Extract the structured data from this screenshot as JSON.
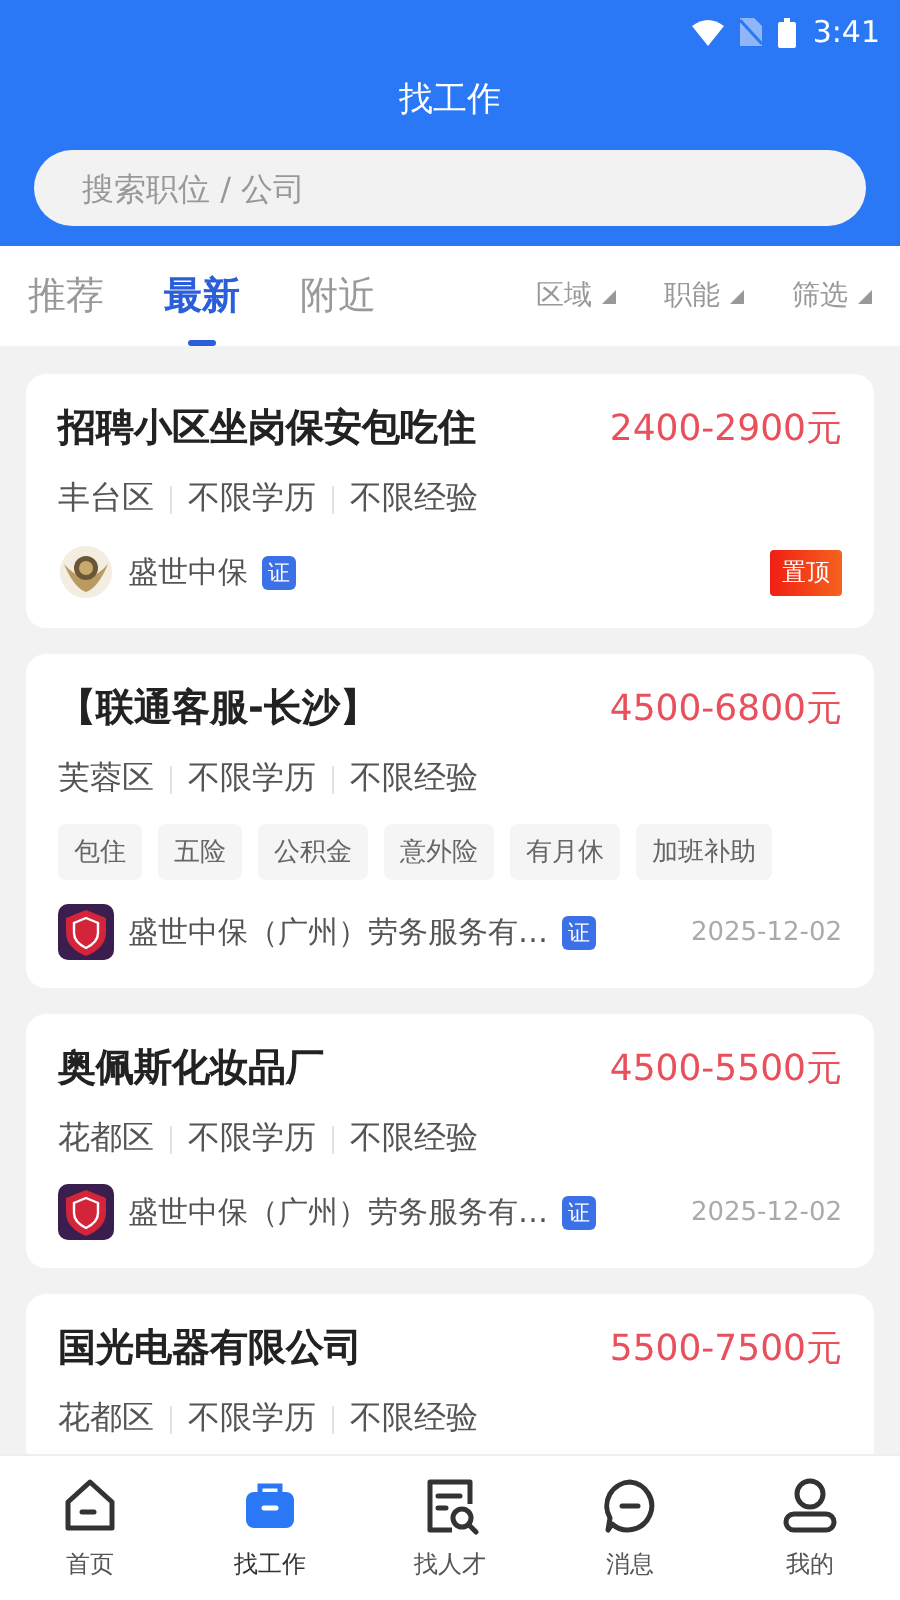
{
  "status_bar": {
    "time": "3:41"
  },
  "header": {
    "title": "找工作"
  },
  "search": {
    "placeholder": "搜索职位 / 公司"
  },
  "tabs": [
    {
      "label": "推荐",
      "selected": false
    },
    {
      "label": "最新",
      "selected": true
    },
    {
      "label": "附近",
      "selected": false
    }
  ],
  "filters": [
    "区域",
    "职能",
    "筛选"
  ],
  "jobs": [
    {
      "title": "招聘小区坐岗保安包吃住",
      "salary": "2400-2900元",
      "meta": [
        "丰台区",
        "不限学历",
        "不限经验"
      ],
      "company": {
        "kind": "emblem",
        "name": "盛世中保",
        "verified_badge": "证"
      },
      "pinned_badge": "置顶"
    },
    {
      "title": "【联通客服-长沙】",
      "salary": "4500-6800元",
      "meta": [
        "芙蓉区",
        "不限学历",
        "不限经验"
      ],
      "tags": [
        "包住",
        "五险",
        "公积金",
        "意外险",
        "有月休",
        "加班补助"
      ],
      "company": {
        "kind": "shield",
        "name": "盛世中保（广州）劳务服务有…",
        "verified_badge": "证"
      },
      "date": "2025-12-02"
    },
    {
      "title": "奥佩斯化妆品厂",
      "salary": "4500-5500元",
      "meta": [
        "花都区",
        "不限学历",
        "不限经验"
      ],
      "company": {
        "kind": "shield",
        "name": "盛世中保（广州）劳务服务有…",
        "verified_badge": "证"
      },
      "date": "2025-12-02"
    },
    {
      "title": "国光电器有限公司",
      "salary": "5500-7500元",
      "meta": [
        "花都区",
        "不限学历",
        "不限经验"
      ]
    }
  ],
  "nav": [
    {
      "label": "首页",
      "selected": false
    },
    {
      "label": "找工作",
      "selected": true
    },
    {
      "label": "找人才",
      "selected": false
    },
    {
      "label": "消息",
      "selected": false
    },
    {
      "label": "我的",
      "selected": false
    }
  ]
}
